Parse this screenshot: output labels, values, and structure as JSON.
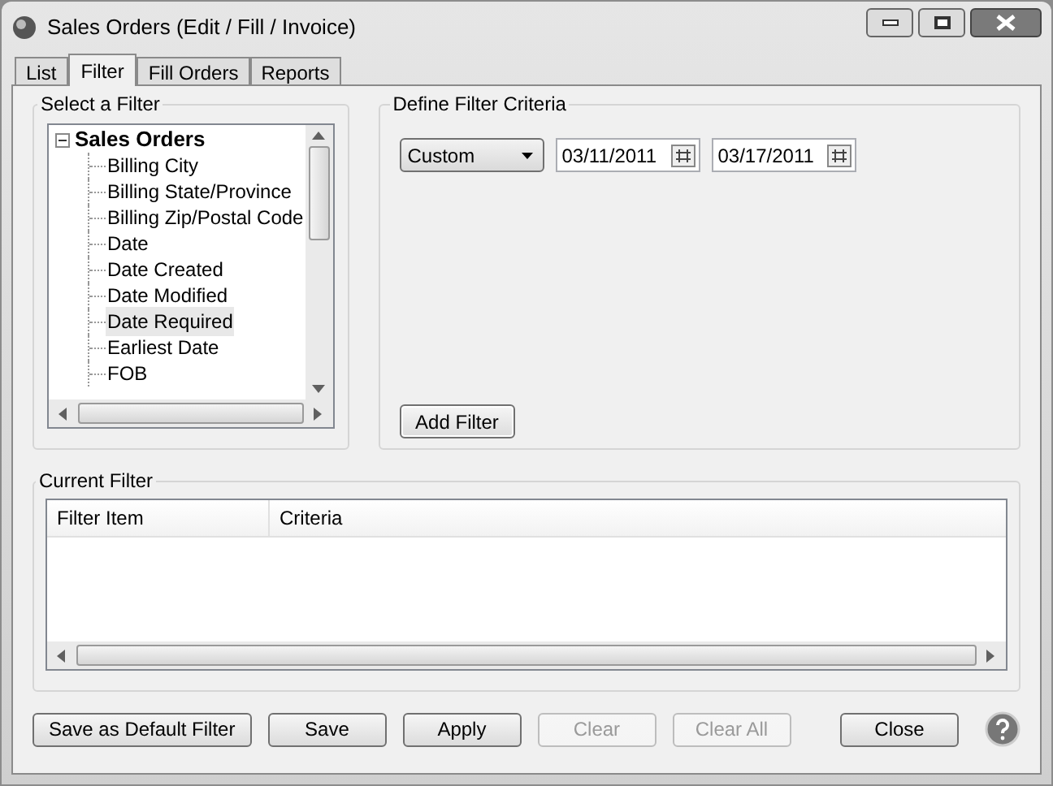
{
  "window": {
    "title": "Sales Orders (Edit / Fill / Invoice)"
  },
  "tabs": [
    {
      "label": "List",
      "selected": false
    },
    {
      "label": "Filter",
      "selected": true
    },
    {
      "label": "Fill Orders",
      "selected": false
    },
    {
      "label": "Reports",
      "selected": false
    }
  ],
  "select_filter": {
    "legend": "Select a Filter",
    "tree": {
      "label": "Sales Orders",
      "expanded": true,
      "children": [
        {
          "label": "Billing City",
          "selected": false
        },
        {
          "label": "Billing State/Province",
          "selected": false
        },
        {
          "label": "Billing Zip/Postal Code",
          "selected": false
        },
        {
          "label": "Date",
          "selected": false
        },
        {
          "label": "Date Created",
          "selected": false
        },
        {
          "label": "Date Modified",
          "selected": false
        },
        {
          "label": "Date Required",
          "selected": true
        },
        {
          "label": "Earliest Date",
          "selected": false
        },
        {
          "label": "FOB",
          "selected": false
        }
      ]
    }
  },
  "criteria": {
    "legend": "Define Filter Criteria",
    "range": "Custom",
    "date_from": "03/11/2011",
    "date_to": "03/17/2011",
    "add_button": "Add Filter"
  },
  "current_filter": {
    "legend": "Current Filter",
    "columns": [
      "Filter Item",
      "Criteria"
    ]
  },
  "buttons": [
    {
      "label": "Save as Default Filter",
      "disabled": false
    },
    {
      "label": "Save",
      "disabled": false
    },
    {
      "label": "Apply",
      "disabled": false
    },
    {
      "label": "Clear",
      "disabled": true
    },
    {
      "label": "Clear All",
      "disabled": true
    },
    {
      "label": "Close",
      "disabled": false
    }
  ]
}
